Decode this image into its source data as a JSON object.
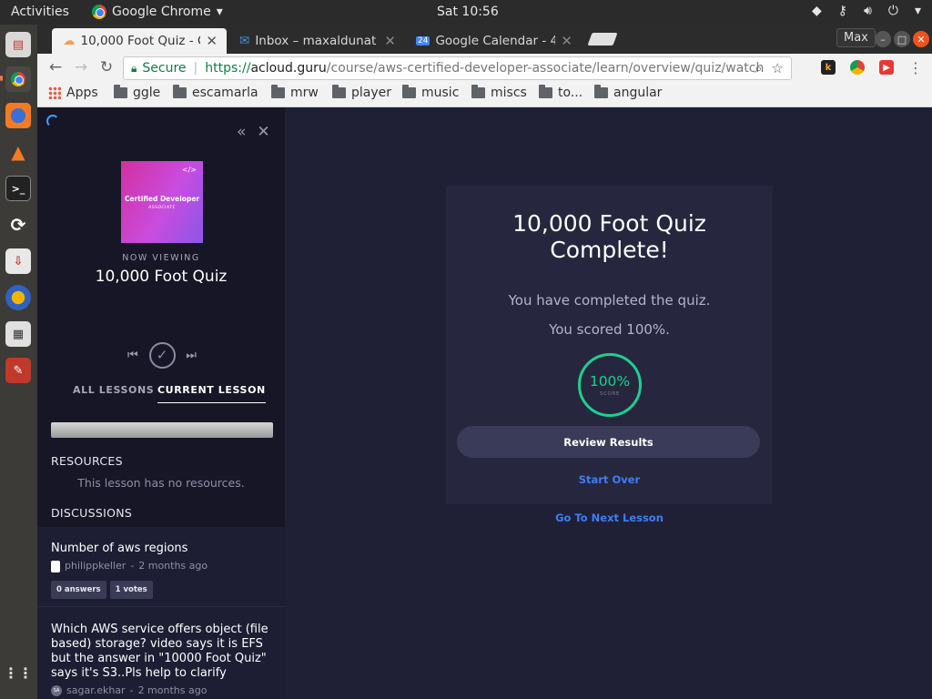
{
  "topbar": {
    "activities": "Activities",
    "app_name": "Google Chrome",
    "clock": "Sat 10:56"
  },
  "tabs": [
    {
      "title": "10,000 Foot Quiz - C"
    },
    {
      "title": "Inbox – maxaldunat"
    },
    {
      "title": "Google Calendar - 4"
    }
  ],
  "window": {
    "profile": "Max"
  },
  "omnibox": {
    "secure_label": "Secure",
    "scheme": "https://",
    "host": "acloud.guru",
    "path": "/course/aws-certified-developer-associate/learn/overview/quiz/watch"
  },
  "bookmarks": {
    "apps": "Apps",
    "folders": [
      "ggle",
      "escamarla",
      "mrw",
      "player",
      "music",
      "miscs",
      "to...",
      "angular"
    ]
  },
  "sidebar": {
    "thumb_title": "Certified Developer",
    "thumb_sub": "ASSOCIATE",
    "now_viewing": "NOW VIEWING",
    "lesson_title": "10,000 Foot Quiz",
    "tab_all": "ALL LESSONS",
    "tab_current": "CURRENT LESSON",
    "resources_heading": "RESOURCES",
    "no_resources": "This lesson has no resources.",
    "discussions_heading": "DISCUSSIONS",
    "discussions": [
      {
        "title": "Number of aws regions",
        "author": "philippkeller",
        "age": "2 months ago",
        "answers": "0 answers",
        "votes": "1 votes"
      },
      {
        "title": "Which AWS service offers object (file based) storage? video says it is EFS but the answer in \"10000 Foot Quiz\" says it's S3..Pls help to clarify",
        "author": "sagar.ekhar",
        "age": "2 months ago"
      }
    ]
  },
  "quiz": {
    "title_line1": "10,000 Foot Quiz",
    "title_line2": "Complete!",
    "completed_text": "You have completed the quiz.",
    "score_text": "You scored 100%.",
    "score_value": "100%",
    "score_label": "SCORE",
    "review_button": "Review Results",
    "start_over": "Start Over",
    "next_lesson": "Go To Next Lesson"
  },
  "colors": {
    "page_bg": "#1f2036",
    "sidebar_bg": "#161626",
    "card_bg": "#26273f",
    "score_green": "#1ecf8f",
    "link_blue": "#3f7ef2"
  }
}
